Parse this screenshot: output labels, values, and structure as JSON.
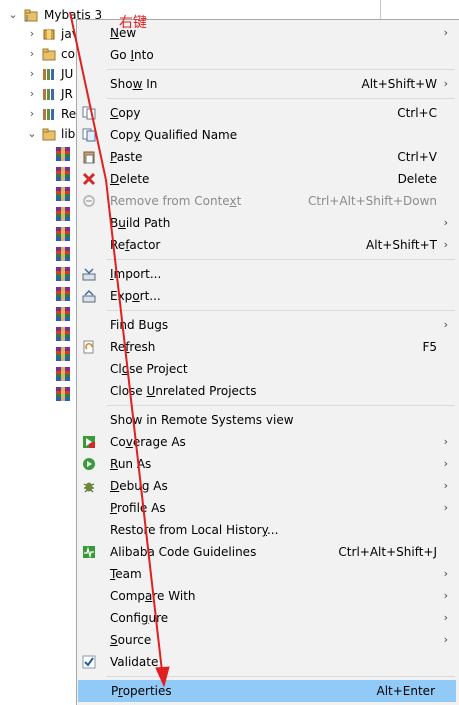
{
  "tree": {
    "project": "Mybatis 3",
    "items": [
      {
        "label": "jav",
        "type": "package"
      },
      {
        "label": "co",
        "type": "package"
      },
      {
        "label": "JU",
        "type": "library"
      },
      {
        "label": "JR",
        "type": "library"
      },
      {
        "label": "Re",
        "type": "library"
      },
      {
        "label": "lib",
        "type": "folder"
      }
    ],
    "jar_count": 13
  },
  "annotation": {
    "note": "右键",
    "color": "#e02020"
  },
  "menu": {
    "items": [
      {
        "pre": "",
        "mn": "N",
        "post": "ew",
        "shortcut": "",
        "submenu": true,
        "disabled": false,
        "icon": ""
      },
      {
        "pre": "Go ",
        "mn": "I",
        "post": "nto",
        "shortcut": "",
        "submenu": false,
        "disabled": false,
        "icon": ""
      },
      {
        "sep": true
      },
      {
        "pre": "Sho",
        "mn": "w",
        "post": " In",
        "shortcut": "Alt+Shift+W",
        "submenu": true,
        "disabled": false,
        "icon": ""
      },
      {
        "sep": true
      },
      {
        "pre": "",
        "mn": "C",
        "post": "opy",
        "shortcut": "Ctrl+C",
        "submenu": false,
        "disabled": false,
        "icon": "copy-icon"
      },
      {
        "pre": "Cop",
        "mn": "y",
        "post": " Qualified Name",
        "shortcut": "",
        "submenu": false,
        "disabled": false,
        "icon": "copy-qualified-name-icon"
      },
      {
        "pre": "",
        "mn": "P",
        "post": "aste",
        "shortcut": "Ctrl+V",
        "submenu": false,
        "disabled": false,
        "icon": "paste-icon"
      },
      {
        "pre": "",
        "mn": "D",
        "post": "elete",
        "shortcut": "Delete",
        "submenu": false,
        "disabled": false,
        "icon": "delete-icon"
      },
      {
        "pre": "Remove from Conte",
        "mn": "x",
        "post": "t",
        "shortcut": "Ctrl+Alt+Shift+Down",
        "submenu": false,
        "disabled": true,
        "icon": "remove-from-context-icon"
      },
      {
        "pre": "B",
        "mn": "u",
        "post": "ild Path",
        "shortcut": "",
        "submenu": true,
        "disabled": false,
        "icon": ""
      },
      {
        "pre": "Re",
        "mn": "f",
        "post": "actor",
        "shortcut": "Alt+Shift+T",
        "submenu": true,
        "disabled": false,
        "icon": ""
      },
      {
        "sep": true
      },
      {
        "pre": "",
        "mn": "I",
        "post": "mport...",
        "shortcut": "",
        "submenu": false,
        "disabled": false,
        "icon": "import-icon"
      },
      {
        "pre": "Exp",
        "mn": "o",
        "post": "rt...",
        "shortcut": "",
        "submenu": false,
        "disabled": false,
        "icon": "export-icon"
      },
      {
        "sep": true
      },
      {
        "pre": "Find Bugs",
        "mn": "",
        "post": "",
        "shortcut": "",
        "submenu": true,
        "disabled": false,
        "icon": ""
      },
      {
        "pre": "Re",
        "mn": "f",
        "post": "resh",
        "shortcut": "F5",
        "submenu": false,
        "disabled": false,
        "icon": "refresh-icon"
      },
      {
        "pre": "Cl",
        "mn": "o",
        "post": "se Project",
        "shortcut": "",
        "submenu": false,
        "disabled": false,
        "icon": ""
      },
      {
        "pre": "Close ",
        "mn": "U",
        "post": "nrelated Projects",
        "shortcut": "",
        "submenu": false,
        "disabled": false,
        "icon": ""
      },
      {
        "sep": true
      },
      {
        "pre": "Show in Remote Systems view",
        "mn": "",
        "post": "",
        "shortcut": "",
        "submenu": false,
        "disabled": false,
        "icon": ""
      },
      {
        "pre": "Co",
        "mn": "v",
        "post": "erage As",
        "shortcut": "",
        "submenu": true,
        "disabled": false,
        "icon": "coverage-icon"
      },
      {
        "pre": "",
        "mn": "R",
        "post": "un As",
        "shortcut": "",
        "submenu": true,
        "disabled": false,
        "icon": "run-icon"
      },
      {
        "pre": "",
        "mn": "D",
        "post": "ebug As",
        "shortcut": "",
        "submenu": true,
        "disabled": false,
        "icon": "debug-icon"
      },
      {
        "pre": "",
        "mn": "P",
        "post": "rofile As",
        "shortcut": "",
        "submenu": true,
        "disabled": false,
        "icon": ""
      },
      {
        "pre": "Restore from Local Histor",
        "mn": "y",
        "post": "...",
        "shortcut": "",
        "submenu": false,
        "disabled": false,
        "icon": ""
      },
      {
        "pre": "Alibaba Code Guidelines",
        "mn": "",
        "post": "",
        "shortcut": "Ctrl+Alt+Shift+J",
        "submenu": false,
        "disabled": false,
        "icon": "alibaba-guidelines-icon"
      },
      {
        "pre": "",
        "mn": "T",
        "post": "eam",
        "shortcut": "",
        "submenu": true,
        "disabled": false,
        "icon": ""
      },
      {
        "pre": "Comp",
        "mn": "a",
        "post": "re With",
        "shortcut": "",
        "submenu": true,
        "disabled": false,
        "icon": ""
      },
      {
        "pre": "Confi",
        "mn": "g",
        "post": "ure",
        "shortcut": "",
        "submenu": true,
        "disabled": false,
        "icon": ""
      },
      {
        "pre": "",
        "mn": "S",
        "post": "ource",
        "shortcut": "",
        "submenu": true,
        "disabled": false,
        "icon": ""
      },
      {
        "pre": "Validate",
        "mn": "",
        "post": "",
        "shortcut": "",
        "submenu": false,
        "disabled": false,
        "icon": "validate-check-icon"
      },
      {
        "sep": true
      },
      {
        "pre": "P",
        "mn": "r",
        "post": "operties",
        "shortcut": "Alt+Enter",
        "submenu": false,
        "disabled": false,
        "icon": "",
        "selected": true
      }
    ]
  }
}
